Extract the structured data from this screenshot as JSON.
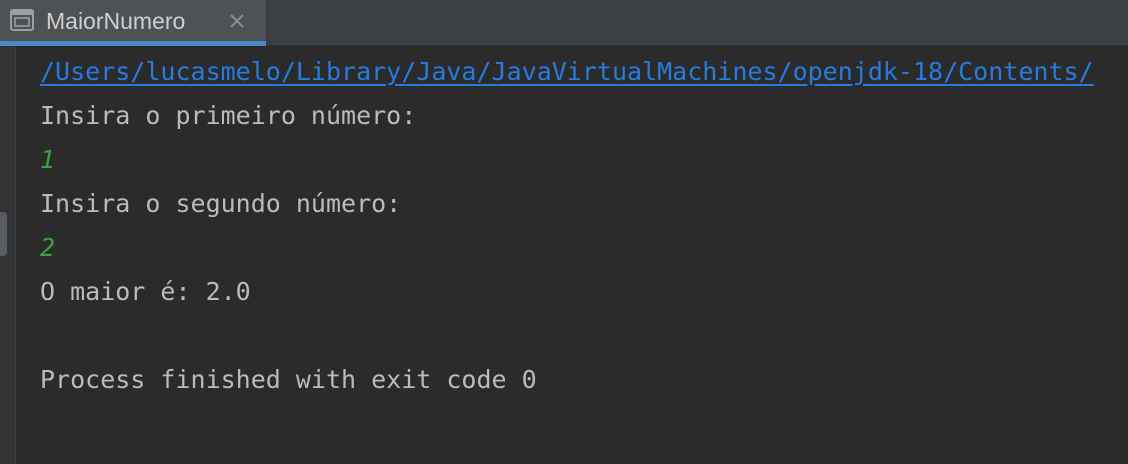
{
  "tab": {
    "title": "MaiorNumero"
  },
  "console": {
    "command_path": "/Users/lucasmelo/Library/Java/JavaVirtualMachines/openjdk-18/Contents/",
    "prompt_first": "Insira o primeiro número:",
    "input_first": "1",
    "prompt_second": "Insira o segundo número:",
    "input_second": "2",
    "result": "O maior é: 2.0",
    "exit_message": "Process finished with exit code 0"
  },
  "colors": {
    "background": "#2b2b2b",
    "tabbar": "#3c3f41",
    "tab_active": "#4e5254",
    "tab_underline": "#4a88c7",
    "text": "#bbbbbb",
    "link": "#287bde",
    "user_input": "#3f9f3f"
  },
  "icons": {
    "tab_icon": "console-window-icon",
    "close_icon": "close-icon"
  }
}
